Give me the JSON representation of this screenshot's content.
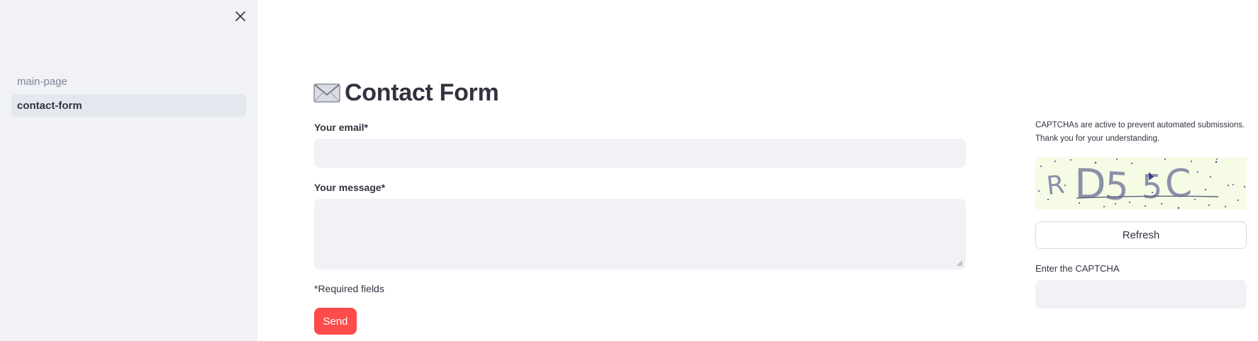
{
  "sidebar": {
    "close_icon": "close-icon",
    "items": [
      {
        "label": "main-page",
        "active": false
      },
      {
        "label": "contact-form",
        "active": true
      }
    ]
  },
  "main": {
    "title_icon": "envelope-icon",
    "title": "Contact Form",
    "email": {
      "label": "Your email*",
      "value": ""
    },
    "message": {
      "label": "Your message*",
      "value": ""
    },
    "required_note": "*Required fields",
    "send_label": "Send"
  },
  "captcha": {
    "note_line1": "CAPTCHAs are active to prevent automated submissions.",
    "note_line2": "Thank you for your understanding.",
    "image_text": "RD55C",
    "refresh_label": "Refresh",
    "input_label": "Enter the CAPTCHA",
    "input_value": ""
  },
  "colors": {
    "sidebar_bg": "#f0f2f6",
    "input_bg": "#f0f2f6",
    "primary_button": "#ff4b4b",
    "text": "#31333f",
    "muted_text": "#808495"
  }
}
